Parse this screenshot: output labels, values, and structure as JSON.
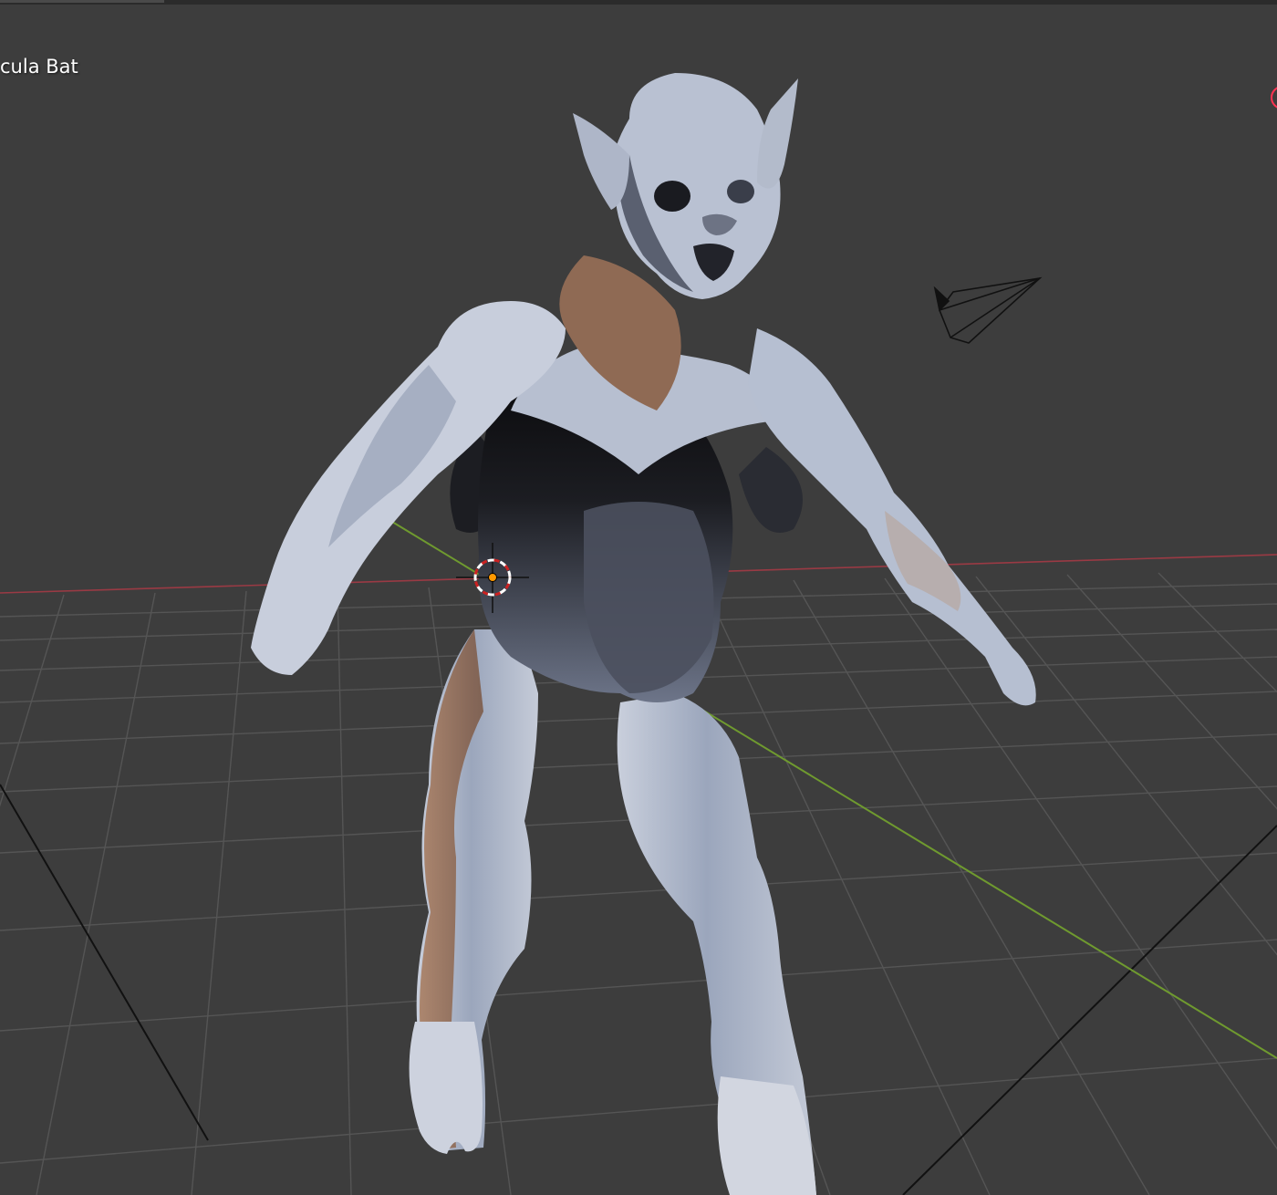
{
  "viewport": {
    "object_label": "cula Bat",
    "background": "#3d3d3d",
    "grid_line_color": "#555555",
    "x_axis_color": "#9a3a44",
    "y_axis_color": "#6f9a2f"
  },
  "scene": {
    "model": "bat-creature-sculpt",
    "model_colors": {
      "light": "#b9c2d6",
      "mid": "#8e98ad",
      "shadow": "#1c1d22",
      "warm": "#a77a5c"
    },
    "camera_object": "camera-icon",
    "cursor_3d": "3d-cursor-icon",
    "origin_point_color": "#ff9900"
  }
}
